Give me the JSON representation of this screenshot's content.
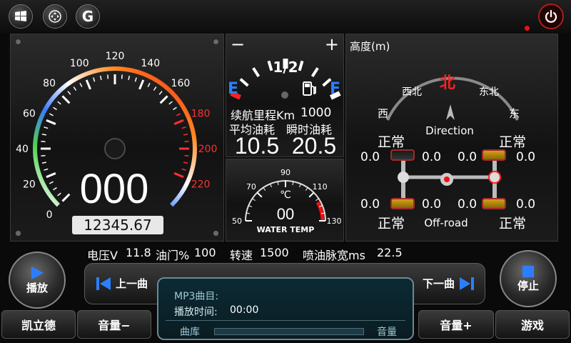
{
  "topbar": {
    "g_button": "G"
  },
  "speedometer": {
    "ticks": [
      {
        "label": "0",
        "angle": 225,
        "color": "#ffffff"
      },
      {
        "label": "20",
        "angle": 202.5,
        "color": "#ffffff"
      },
      {
        "label": "40",
        "angle": 180,
        "color": "#ffffff"
      },
      {
        "label": "60",
        "angle": 157.5,
        "color": "#ffffff"
      },
      {
        "label": "80",
        "angle": 135,
        "color": "#ffffff"
      },
      {
        "label": "100",
        "angle": 112.5,
        "color": "#ffffff"
      },
      {
        "label": "120",
        "angle": 90,
        "color": "#ffffff"
      },
      {
        "label": "140",
        "angle": 67.5,
        "color": "#ffffff"
      },
      {
        "label": "160",
        "angle": 45,
        "color": "#ffffff"
      },
      {
        "label": "180",
        "angle": 22.5,
        "color": "#ff3030"
      },
      {
        "label": "200",
        "angle": 0,
        "color": "#ff3030"
      },
      {
        "label": "220",
        "angle": -22.5,
        "color": "#ff3030"
      }
    ],
    "speed": "000",
    "odometer": "12345.67"
  },
  "fuel": {
    "minus": "−",
    "plus": "+",
    "half": "1/2",
    "empty": "E",
    "full": "F",
    "range_label": "续航里程Km",
    "range_value": "1000",
    "avg_label": "平均油耗",
    "inst_label": "瞬时油耗",
    "avg_value": "10.5",
    "inst_value": "20.5"
  },
  "temp": {
    "labels": [
      {
        "text": "50",
        "angle": 180
      },
      {
        "text": "70",
        "angle": 135
      },
      {
        "text": "90",
        "angle": 90
      },
      {
        "text": "110",
        "angle": 45
      },
      {
        "text": "130",
        "angle": 0
      }
    ],
    "unit": "℃",
    "value": "00",
    "caption": "WATER TEMP"
  },
  "altitude": {
    "title": "高度(m)",
    "compass": {
      "north": "北",
      "northwest": "西北",
      "northeast": "东北",
      "west": "西",
      "east": "东",
      "direction": "Direction"
    },
    "status_fl": "正常",
    "status_fr": "正常",
    "status_rl": "正常",
    "status_rr": "正常",
    "fl_left": "0.0",
    "fl_right": "0.0",
    "fr_left": "0.0",
    "fr_right": "0.0",
    "rl_left": "0.0",
    "rl_right": "0.0",
    "rr_left": "0.0",
    "rr_right": "0.0",
    "mode": "Off-road"
  },
  "info": {
    "voltage_label": "电压V",
    "voltage_value": "11.8",
    "throttle_label": "油门%",
    "throttle_value": "100",
    "rpm_label": "转速",
    "rpm_value": "1500",
    "pulse_label": "喷油脉宽ms",
    "pulse_value": "22.5"
  },
  "player": {
    "play": "播放",
    "stop": "停止",
    "prev": "上一曲",
    "next": "下一曲",
    "track_label": "MP3曲目:",
    "time_label": "播放时间:",
    "time_value": "00:00",
    "library": "曲库",
    "volume": "音量",
    "progress": 0
  },
  "bottom": {
    "brand": "凯立德",
    "vol_down": "音量−",
    "vol_up": "音量+",
    "games": "游戏"
  },
  "colors": {
    "accent_blue": "#2b7fff",
    "warning_red": "#ff2020",
    "amber": "#c89410"
  }
}
